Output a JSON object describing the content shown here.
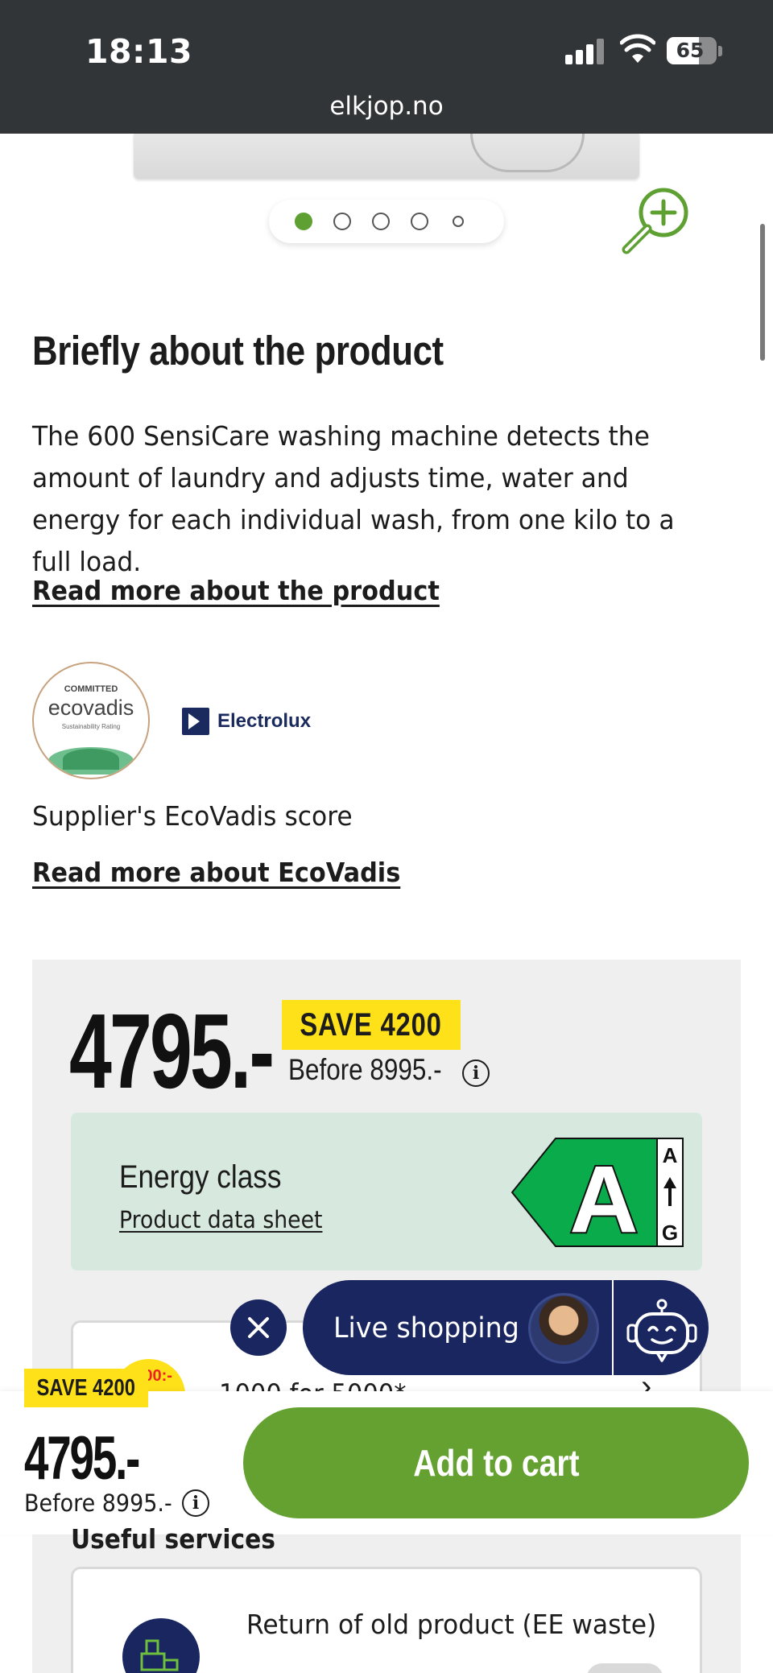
{
  "status_bar": {
    "time": "18:13",
    "url": "elkjop.no",
    "battery": "65",
    "battery_fraction": 0.65
  },
  "gallery": {
    "dots_count": 5,
    "active_index": 0
  },
  "brief": {
    "heading": "Briefly about the product",
    "text": "The 600 SensiCare washing machine detects the amount of laundry and adjusts time, water and energy for each individual wash, from one kilo to a full load.",
    "read_more": "Read more about the product"
  },
  "ecovadis": {
    "badge_top": "COMMITTED",
    "badge_brand": "ecovadis",
    "badge_sub": "Sustainability Rating",
    "supplier_brand": "Electrolux",
    "score_text": "Supplier's EcoVadis score",
    "read_more": "Read more about EcoVadis"
  },
  "price": {
    "current": "4795.-",
    "save": "SAVE 4200",
    "before": "Before 8995.-",
    "info_glyph": "i"
  },
  "energy": {
    "title": "Energy class",
    "link": "Product data sheet",
    "class": "A",
    "scale_top": "A",
    "scale_bottom": "G",
    "color": "#0aab4b"
  },
  "offer": {
    "badge": "1000:-",
    "text": "1000 for 5000*"
  },
  "live": {
    "label": "Live shopping",
    "close_glyph": "✕"
  },
  "sticky": {
    "save": "SAVE 4200",
    "price": "4795.-",
    "before": "Before 8995.-",
    "cart": "Add to cart"
  },
  "services": {
    "title": "Useful services",
    "item_label": "Return of old product (EE waste)"
  },
  "colors": {
    "brand_green": "#65a131",
    "navy": "#1a2660",
    "sale_yellow": "#ffe119"
  }
}
